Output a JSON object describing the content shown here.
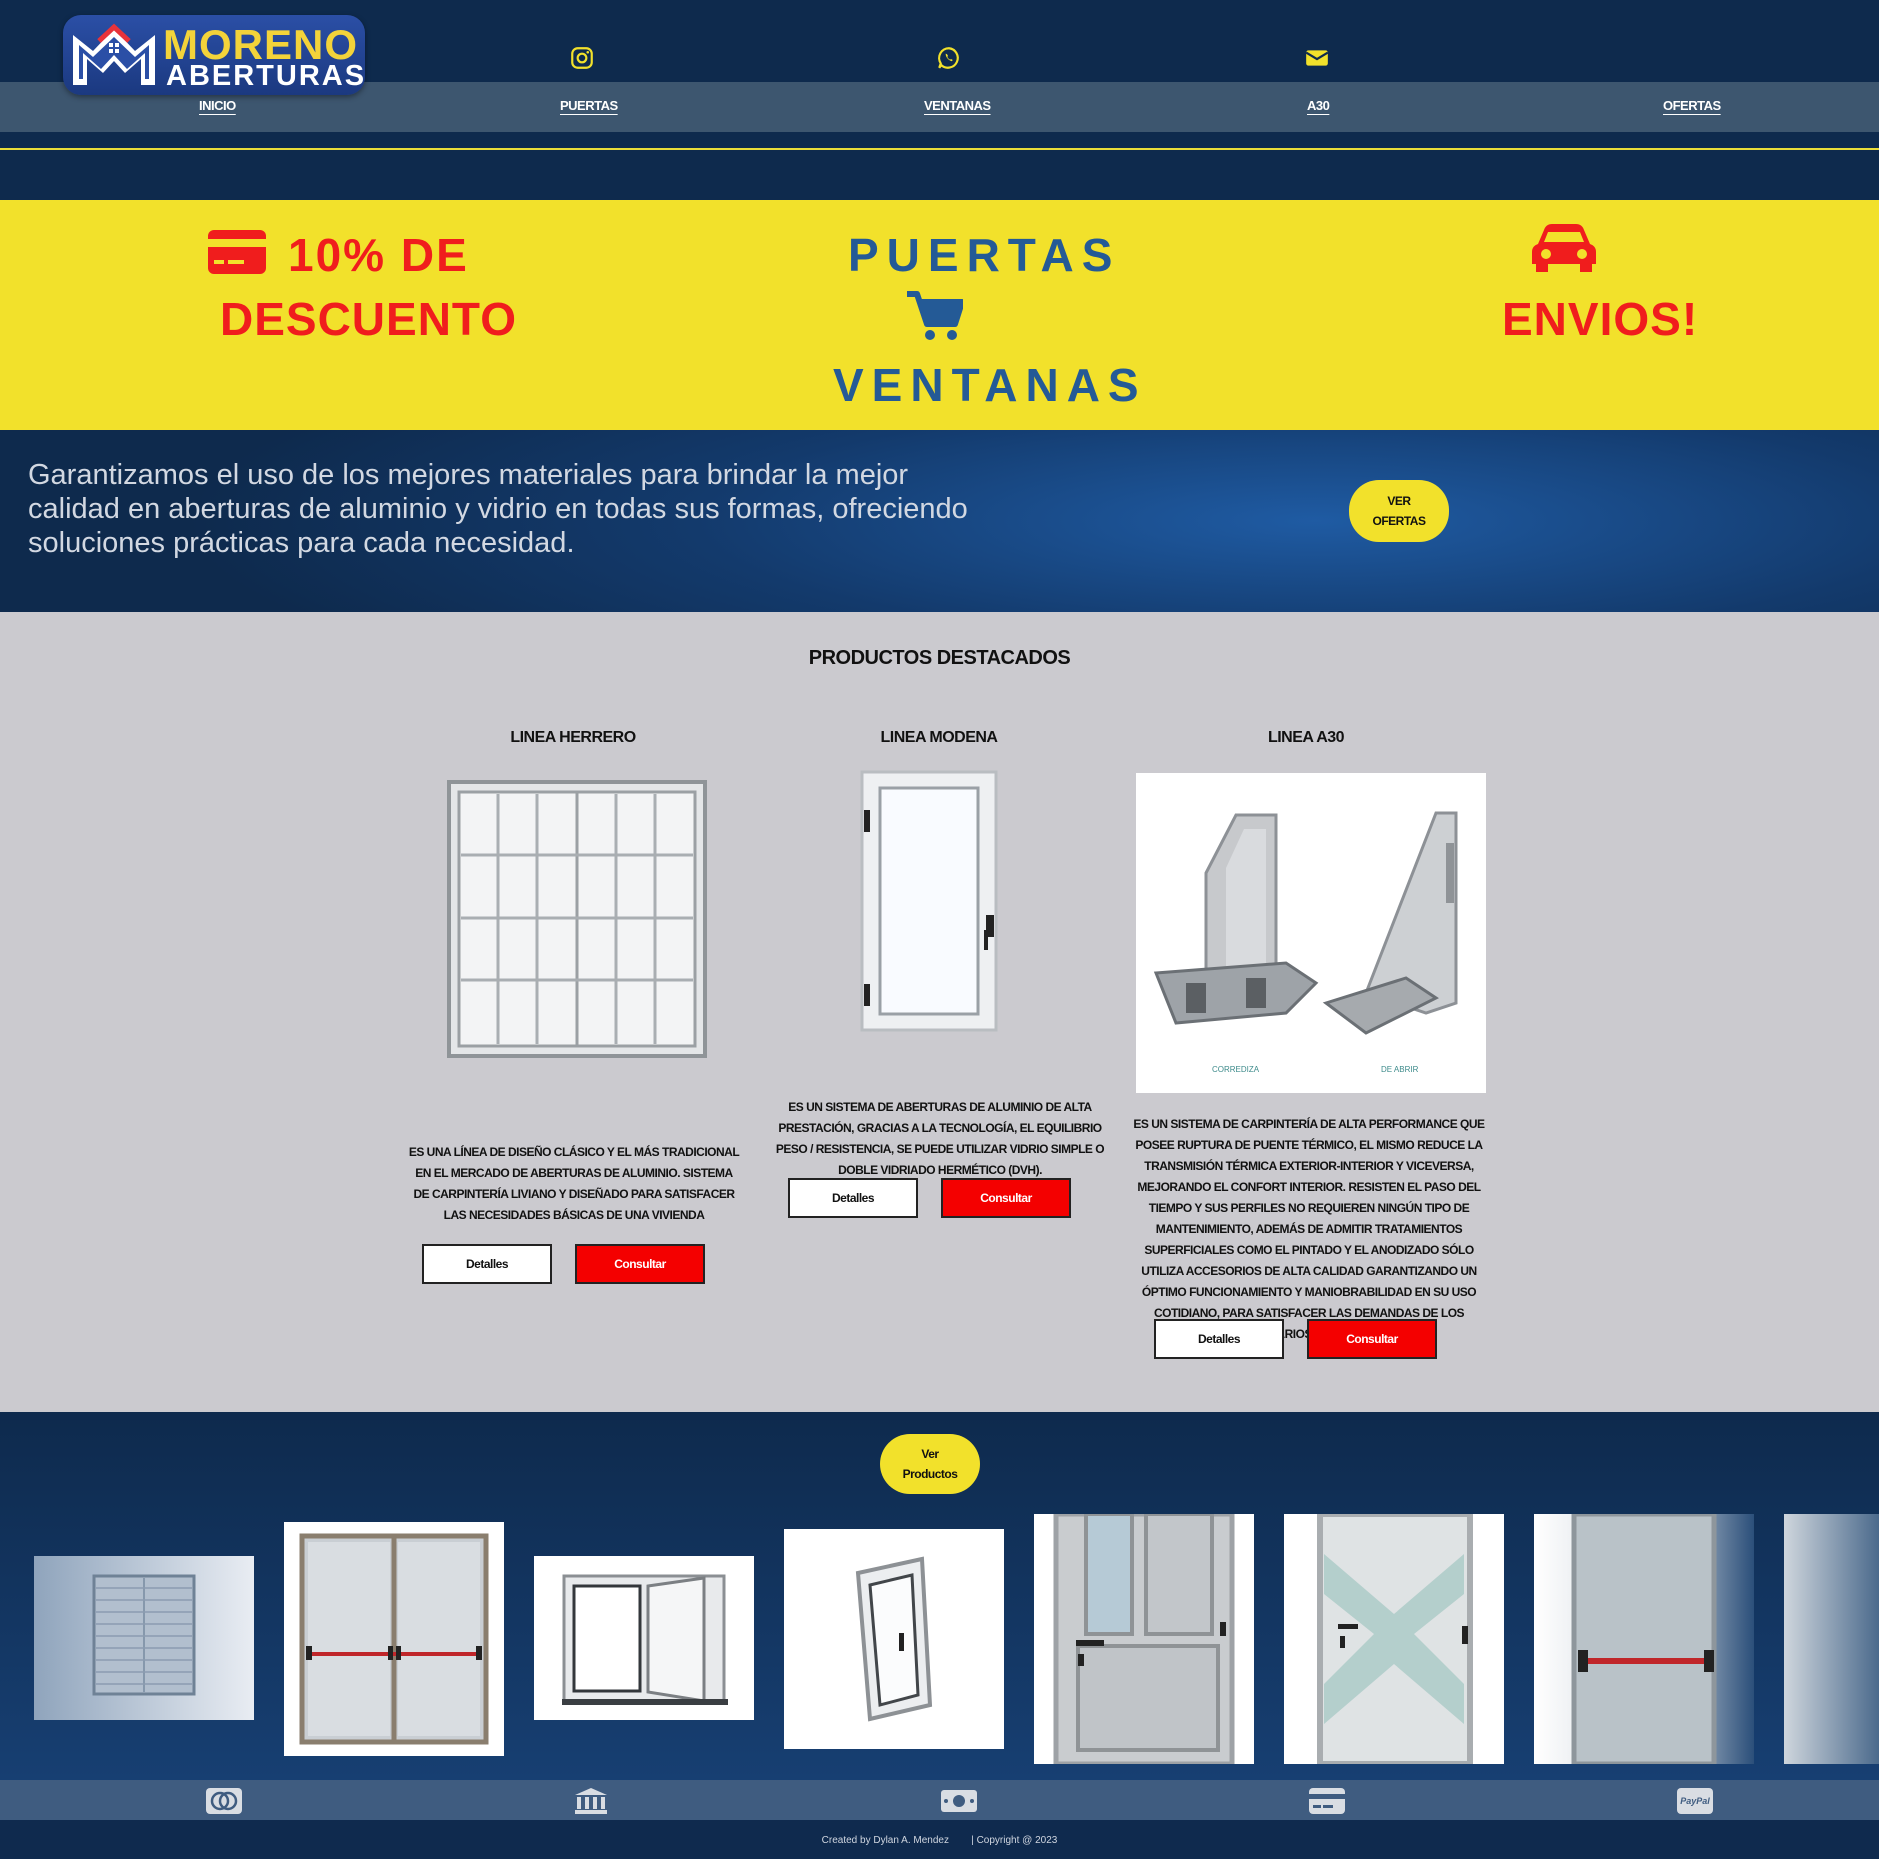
{
  "header": {
    "logo": {
      "line1": "MORENO",
      "line2": "ABERTURAS"
    },
    "social": [
      "instagram-icon",
      "whatsapp-icon",
      "envelope-icon"
    ],
    "nav": [
      "INICIO",
      "PUERTAS",
      "VENTANAS",
      "A30",
      "OFERTAS"
    ]
  },
  "promo": {
    "left_line1": "10% DE",
    "left_line2": "DESCUENTO",
    "mid_line1": "PUERTAS",
    "mid_line2": "VENTANAS",
    "right": "ENVIOS!",
    "colors": {
      "background": "#f2e12b",
      "red": "#f01d1d",
      "blue": "#245a96"
    }
  },
  "intro": {
    "text": "Garantizamos el uso de los mejores materiales para brindar la mejor calidad en aberturas de aluminio y vidrio en todas sus formas, ofreciendo soluciones prácticas para cada necesidad.",
    "button_line1": "VER",
    "button_line2": "OFERTAS"
  },
  "products": {
    "title": "PRODUCTOS DESTACADOS",
    "items": [
      {
        "title": "LINEA HERRERO",
        "description": "Es una línea de diseño clásico y el más tradicional en el mercado de aberturas de aluminio. Sistema de carpintería liviano y diseñado para satisfacer las necesidades básicas de una vivienda",
        "details": "Detalles",
        "consult": "Consultar"
      },
      {
        "title": "LINEA MODENA",
        "description": "Es un sistema de aberturas de aluminio de alta prestación, gracias a la tecnología, el equilibrio peso / resistencia, se puede utilizar vidrio simple o doble vidriado hermético (DVH).",
        "details": "Detalles",
        "consult": "Consultar"
      },
      {
        "title": "LINEA A30",
        "description": "Es un sistema de carpintería de alta performance que posee ruptura de puente térmico, el mismo reduce la transmisión térmica exterior-interior y viceversa, mejorando el confort interior. Resisten el paso del tiempo y sus perfiles no requieren ningún tipo de mantenimiento, además de admitir tratamientos superficiales como el pintado y el anodizado sólo utiliza accesorios de alta calidad garantizando un óptimo funcionamiento y maniobrabilidad en su uso cotidiano, para satisfacer las demandas de los usuarios finales.",
        "image_captions": [
          "CORREDIZA",
          "DE ABRIR"
        ],
        "details": "Detalles",
        "consult": "Consultar"
      }
    ]
  },
  "gallery": {
    "button_line1": "Ver",
    "button_line2": "Productos"
  },
  "payments": [
    "mastercard-icon",
    "bank-icon",
    "cash-icon",
    "credit-card-icon",
    "paypal-icon"
  ],
  "payment_paypal_label": "PayPal",
  "footer": {
    "created": "Created by Dylan A. Mendez",
    "copyright": "| Copyright @ 2023"
  }
}
